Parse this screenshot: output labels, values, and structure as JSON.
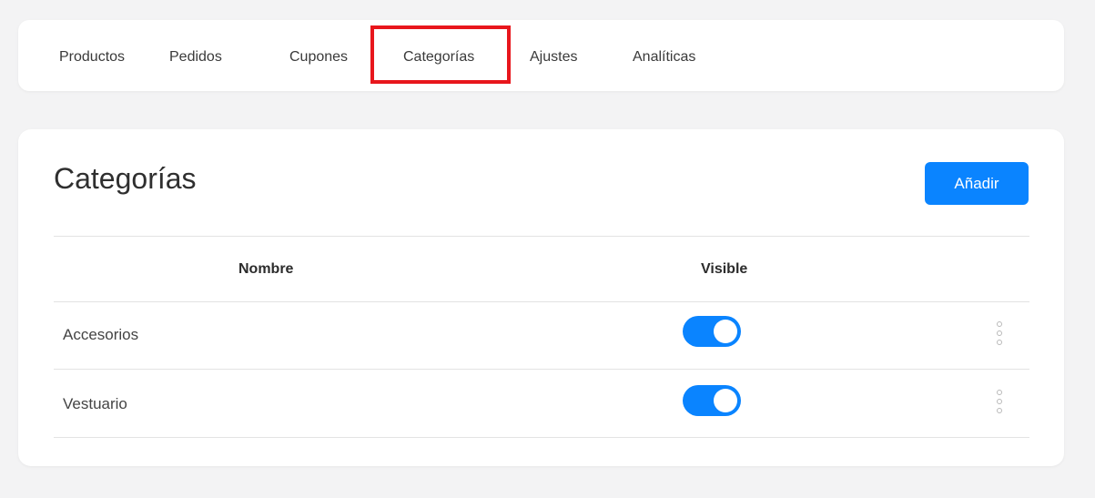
{
  "nav": {
    "items": [
      {
        "label": "Productos"
      },
      {
        "label": "Pedidos"
      },
      {
        "label": "Cupones"
      },
      {
        "label": "Categorías"
      },
      {
        "label": "Ajustes"
      },
      {
        "label": "Analíticas"
      }
    ],
    "active_item": "Categorías"
  },
  "page": {
    "title": "Categorías",
    "add_label": "Añadir"
  },
  "table": {
    "headers": {
      "name": "Nombre",
      "visible": "Visible"
    },
    "rows": [
      {
        "name": "Accesorios",
        "visible": true
      },
      {
        "name": "Vestuario",
        "visible": true
      }
    ]
  },
  "colors": {
    "accent": "#0a84ff",
    "highlight": "#e8161c",
    "background": "#f3f3f4"
  }
}
